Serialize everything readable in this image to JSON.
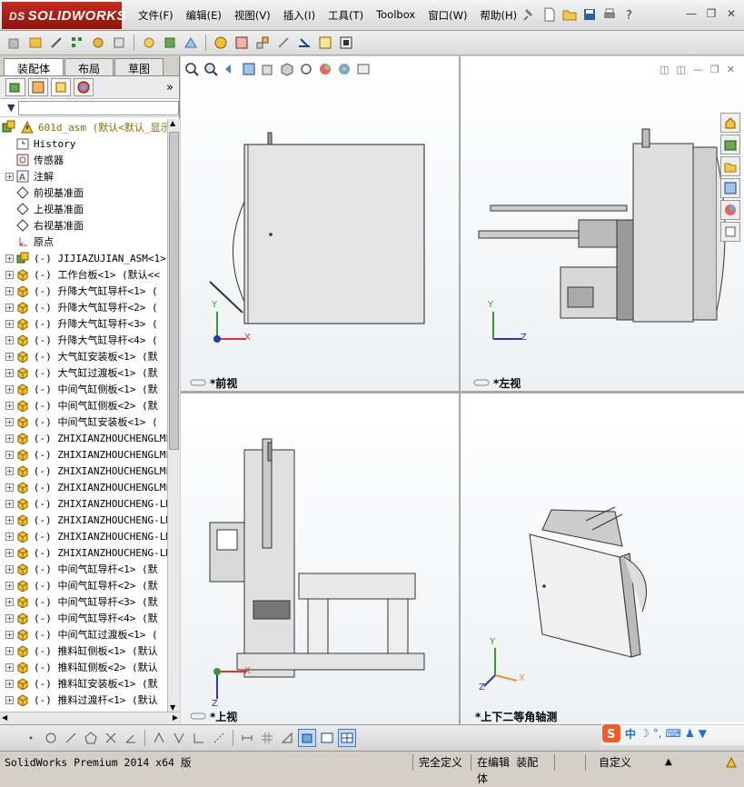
{
  "app": {
    "logo": "SOLIDWORKS",
    "logo_prefix": "DS"
  },
  "menu": [
    "文件(F)",
    "编辑(E)",
    "视图(V)",
    "插入(I)",
    "工具(T)",
    "Toolbox",
    "窗口(W)",
    "帮助(H)"
  ],
  "panel_tabs": [
    "装配体",
    "布局",
    "草图"
  ],
  "tree": {
    "root": "601d_asm  (默认<默认_显示",
    "items": [
      {
        "label": "History",
        "icon": "history-icon",
        "expand": false
      },
      {
        "label": "传感器",
        "icon": "sensor-icon",
        "expand": false
      },
      {
        "label": "注解",
        "icon": "annotation-icon",
        "expand": true
      },
      {
        "label": "前视基准面",
        "icon": "plane-icon",
        "expand": false
      },
      {
        "label": "上视基准面",
        "icon": "plane-icon",
        "expand": false
      },
      {
        "label": "右视基准面",
        "icon": "plane-icon",
        "expand": false
      },
      {
        "label": "原点",
        "icon": "origin-icon",
        "expand": false
      },
      {
        "label": "(-) JIJIAZUJIAN_ASM<1>",
        "icon": "subassembly-icon",
        "expand": true
      },
      {
        "label": "(-) 工作台板<1> (默认<<",
        "icon": "part-icon",
        "expand": true
      },
      {
        "label": "(-) 升降大气缸导杆<1> (",
        "icon": "part-icon",
        "expand": true
      },
      {
        "label": "(-) 升降大气缸导杆<2> (",
        "icon": "part-icon",
        "expand": true
      },
      {
        "label": "(-) 升降大气缸导杆<3> (",
        "icon": "part-icon",
        "expand": true
      },
      {
        "label": "(-) 升降大气缸导杆<4> (",
        "icon": "part-icon",
        "expand": true
      },
      {
        "label": "(-) 大气缸安装板<1> (默",
        "icon": "part-icon",
        "expand": true
      },
      {
        "label": "(-) 大气缸过渡板<1> (默",
        "icon": "part-icon",
        "expand": true
      },
      {
        "label": "(-) 中间气缸侧板<1> (默",
        "icon": "part-icon",
        "expand": true
      },
      {
        "label": "(-) 中间气缸侧板<2> (默",
        "icon": "part-icon",
        "expand": true
      },
      {
        "label": "(-) 中间气缸安装板<1> (",
        "icon": "part-icon",
        "expand": true
      },
      {
        "label": "(-) ZHIXIANZHOUCHENGLMF",
        "icon": "part-icon",
        "expand": true
      },
      {
        "label": "(-) ZHIXIANZHOUCHENGLMF",
        "icon": "part-icon",
        "expand": true
      },
      {
        "label": "(-) ZHIXIANZHOUCHENGLMF",
        "icon": "part-icon",
        "expand": true
      },
      {
        "label": "(-) ZHIXIANZHOUCHENGLMF",
        "icon": "part-icon",
        "expand": true
      },
      {
        "label": "(-) ZHIXIANZHOUCHENG-LM",
        "icon": "part-icon",
        "expand": true
      },
      {
        "label": "(-) ZHIXIANZHOUCHENG-LM",
        "icon": "part-icon",
        "expand": true
      },
      {
        "label": "(-) ZHIXIANZHOUCHENG-LM",
        "icon": "part-icon",
        "expand": true
      },
      {
        "label": "(-) ZHIXIANZHOUCHENG-LM",
        "icon": "part-icon",
        "expand": true
      },
      {
        "label": "(-) 中间气缸导杆<1> (默",
        "icon": "part-icon",
        "expand": true
      },
      {
        "label": "(-) 中间气缸导杆<2> (默",
        "icon": "part-icon",
        "expand": true
      },
      {
        "label": "(-) 中间气缸导杆<3> (默",
        "icon": "part-icon",
        "expand": true
      },
      {
        "label": "(-) 中间气缸导杆<4> (默",
        "icon": "part-icon",
        "expand": true
      },
      {
        "label": "(-) 中间气缸过渡板<1> (",
        "icon": "part-icon",
        "expand": true
      },
      {
        "label": "(-) 推料缸侧板<1> (默认",
        "icon": "part-icon",
        "expand": true
      },
      {
        "label": "(-) 推料缸侧板<2> (默认",
        "icon": "part-icon",
        "expand": true
      },
      {
        "label": "(-) 推料缸安装板<1> (默",
        "icon": "part-icon",
        "expand": true
      },
      {
        "label": "(-) 推料过渡杆<1> (默认",
        "icon": "part-icon",
        "expand": true
      }
    ]
  },
  "viewports": {
    "front": "*前视",
    "left": "*左视",
    "top": "*上视",
    "iso": "*上下二等角轴测"
  },
  "axes": {
    "x": "X",
    "y": "Y",
    "z": "Z"
  },
  "status": {
    "version": "SolidWorks Premium 2014 x64 版",
    "defined": "完全定义",
    "editing": "在编辑 装配体",
    "units": "自定义"
  },
  "ime": {
    "label": "中"
  }
}
